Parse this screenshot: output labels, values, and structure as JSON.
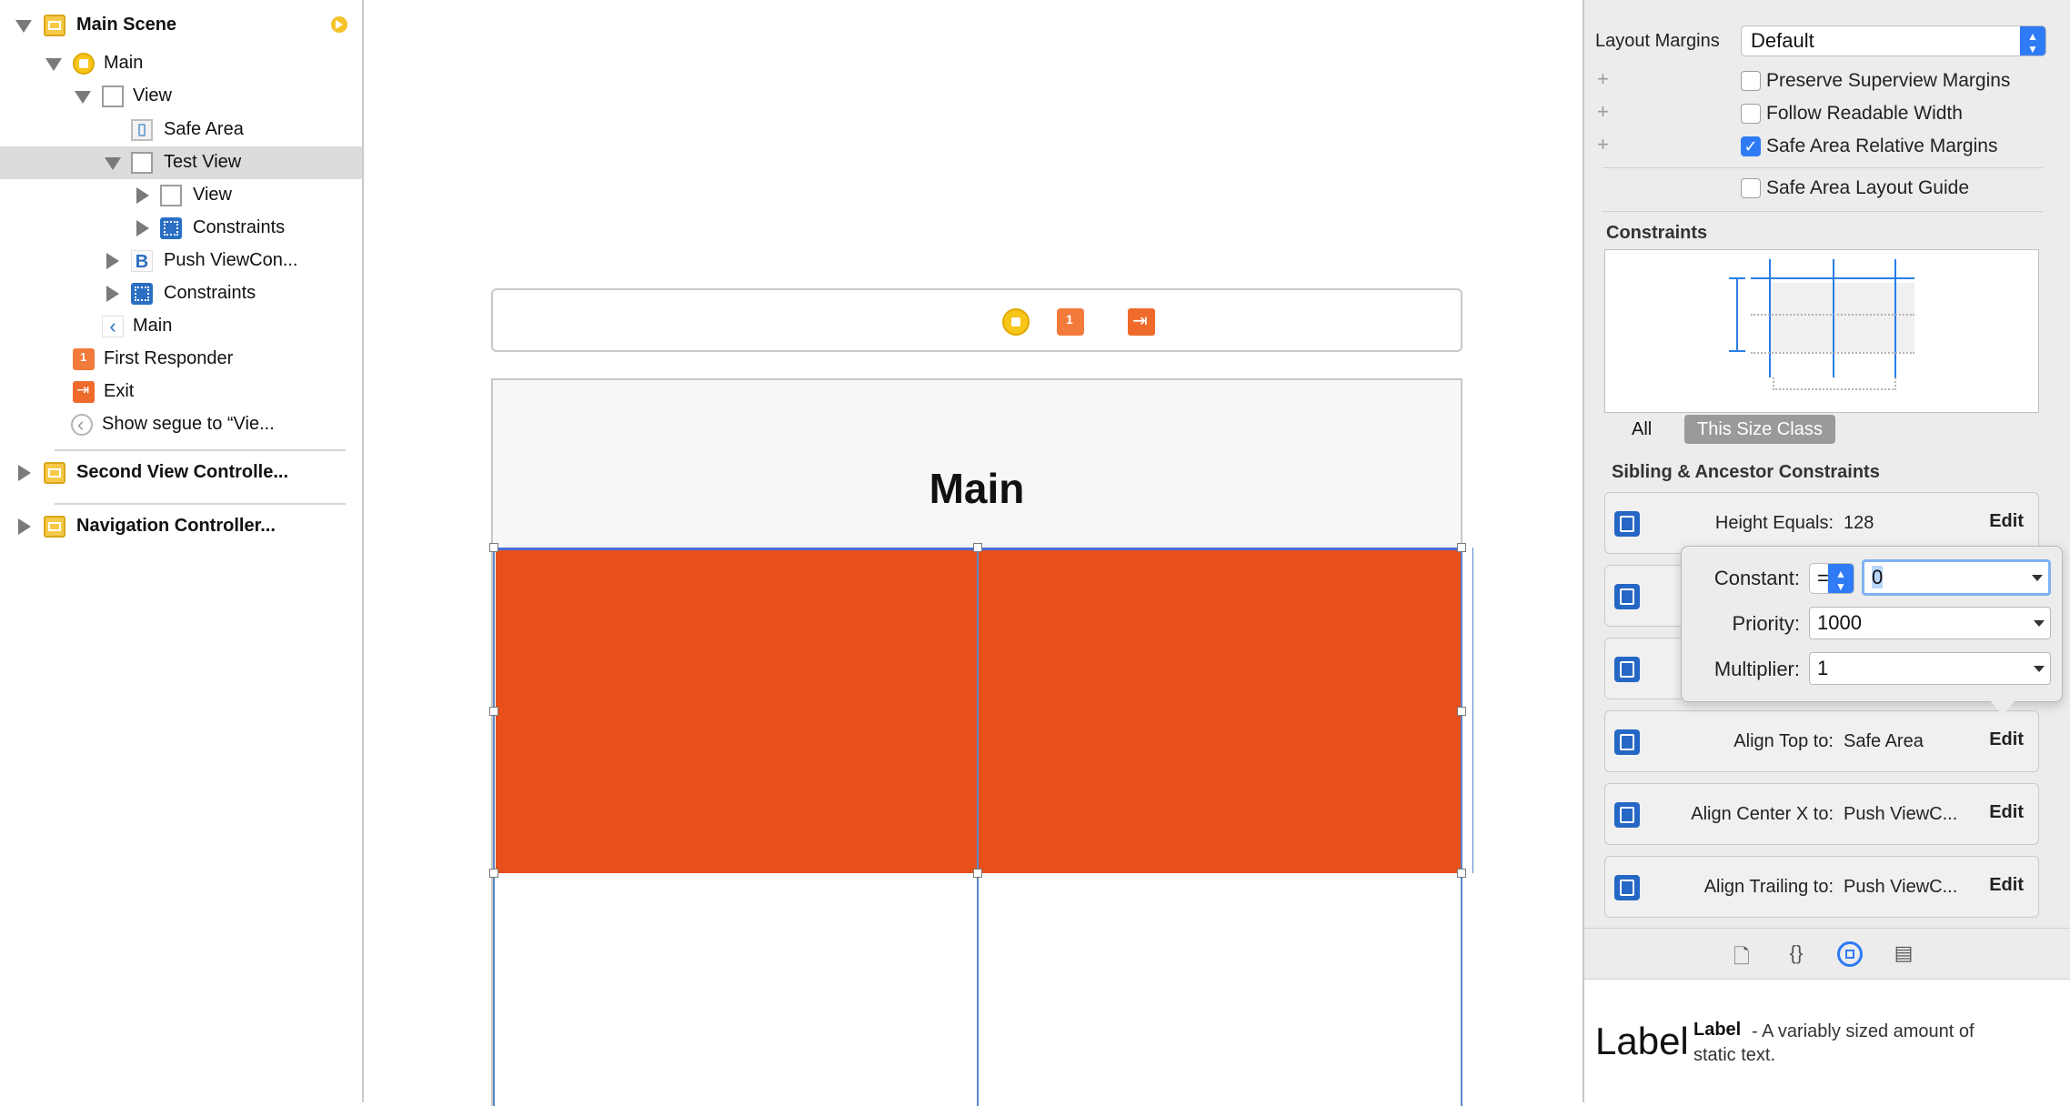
{
  "outline": {
    "items": [
      {
        "label": "Main Scene",
        "bold": true
      },
      {
        "label": "Main"
      },
      {
        "label": "View"
      },
      {
        "label": "Safe Area"
      },
      {
        "label": "Test View"
      },
      {
        "label": "View"
      },
      {
        "label": "Constraints"
      },
      {
        "label": "Push ViewCon..."
      },
      {
        "label": "Constraints"
      },
      {
        "label": "Main"
      },
      {
        "label": "First Responder"
      },
      {
        "label": "Exit"
      },
      {
        "label": "Show segue to “Vie..."
      },
      {
        "label": "Second View Controlle..."
      },
      {
        "label": "Navigation Controller..."
      }
    ],
    "button_glyph": "B"
  },
  "canvas": {
    "nav_title": "Main",
    "accent_color": "#e74f1b"
  },
  "inspector": {
    "layout_margins_label": "Layout Margins",
    "layout_margins_value": "Default",
    "checkboxes": [
      {
        "label": "Preserve Superview Margins",
        "checked": false
      },
      {
        "label": "Follow Readable Width",
        "checked": false
      },
      {
        "label": "Safe Area Relative Margins",
        "checked": true
      },
      {
        "label": "Safe Area Layout Guide",
        "checked": false
      }
    ],
    "constraints_title": "Constraints",
    "segment_all": "All",
    "segment_size_class": "This Size Class",
    "sibling_title": "Sibling & Ancestor Constraints",
    "rows": [
      {
        "label": "Height Equals:",
        "value": "128",
        "edit": "Edit"
      },
      {
        "label": "Align Top to:",
        "value": "Safe Area",
        "edit": "Edit"
      },
      {
        "label": "Align Center X to:",
        "value": "Push ViewC...",
        "edit": "Edit"
      },
      {
        "label": "Align Trailing to:",
        "value": "Push ViewC...",
        "edit": "Edit"
      }
    ],
    "popover": {
      "constant_label": "Constant:",
      "relation": "=",
      "constant_value": "0",
      "priority_label": "Priority:",
      "priority_value": "1000",
      "multiplier_label": "Multiplier:",
      "multiplier_value": "1"
    },
    "library": {
      "preview": "Label",
      "title": "Label",
      "description": "- A variably sized amount of static text."
    }
  }
}
